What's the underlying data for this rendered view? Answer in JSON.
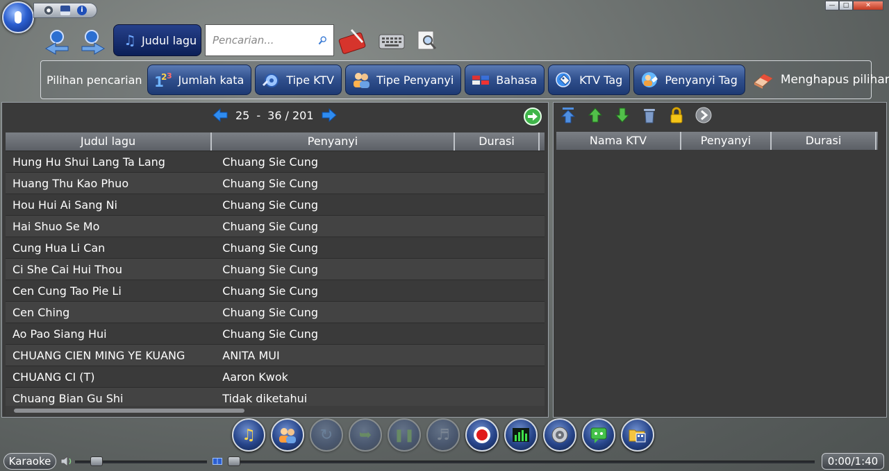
{
  "toolbar": {
    "song_title_button": "Judul lagu",
    "search_placeholder": "Pencarian..."
  },
  "filter": {
    "label": "Pilihan pencarian",
    "buttons": [
      {
        "label": "Jumlah kata",
        "icon": "number-123-icon"
      },
      {
        "label": "Tipe KTV",
        "icon": "ktv-type-icon"
      },
      {
        "label": "Tipe Penyanyi",
        "icon": "singer-type-icon"
      },
      {
        "label": "Bahasa",
        "icon": "language-flags-icon"
      },
      {
        "label": "KTV Tag",
        "icon": "ktv-tag-icon"
      },
      {
        "label": "Penyanyi Tag",
        "icon": "singer-tag-icon"
      }
    ],
    "clear_label": "Menghapus pilihan"
  },
  "song_list": {
    "pager": {
      "from": "25",
      "sep": "-",
      "to": "36",
      "total": "/ 201"
    },
    "columns": [
      "Judul lagu",
      "Penyanyi",
      "Durasi"
    ],
    "rows": [
      {
        "title": "Hung Hu Shui Lang Ta Lang",
        "singer": "Chuang Sie Cung",
        "duration": ""
      },
      {
        "title": "Huang Thu Kao Phuo",
        "singer": "Chuang Sie Cung",
        "duration": ""
      },
      {
        "title": "Hou Hui Ai Sang Ni",
        "singer": "Chuang Sie Cung",
        "duration": ""
      },
      {
        "title": "Hai Shuo Se Mo",
        "singer": "Chuang Sie Cung",
        "duration": ""
      },
      {
        "title": "Cung Hua Li Can",
        "singer": "Chuang Sie Cung",
        "duration": ""
      },
      {
        "title": "Ci She Cai Hui Thou",
        "singer": "Chuang Sie Cung",
        "duration": ""
      },
      {
        "title": "Cen Cung Tao Pie Li",
        "singer": "Chuang Sie Cung",
        "duration": ""
      },
      {
        "title": "Cen Ching",
        "singer": "Chuang Sie Cung",
        "duration": ""
      },
      {
        "title": "Ao Pao Siang Hui",
        "singer": "Chuang Sie Cung",
        "duration": ""
      },
      {
        "title": "CHUANG CIEN MING YE KUANG",
        "singer": "ANITA MUI",
        "duration": ""
      },
      {
        "title": "CHUANG CI (T)",
        "singer": "Aaron Kwok",
        "duration": ""
      },
      {
        "title": "Chuang Bian Gu Shi",
        "singer": "Tidak diketahui",
        "duration": ""
      }
    ]
  },
  "playlist": {
    "columns": [
      "Nama KTV",
      "Penyanyi",
      "Durasi"
    ]
  },
  "bottom": {
    "mode_label": "Karaoke",
    "time": "0:00/1:40"
  }
}
